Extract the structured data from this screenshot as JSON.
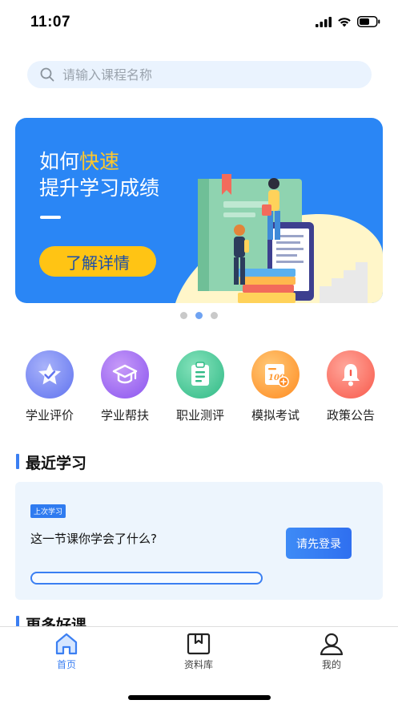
{
  "status": {
    "time": "11:07"
  },
  "search": {
    "placeholder": "请输入课程名称"
  },
  "banner": {
    "title_line1_prefix": "如何",
    "title_line1_highlight": "快速",
    "title_line2": "提升学习成绩",
    "button_label": "了解详情",
    "slide_count": 3,
    "active_slide": 2
  },
  "quick_menu": [
    {
      "label": "学业评价",
      "icon": "star-badge-icon",
      "color_from": "#8f9cf7",
      "color_to": "#5f72ef"
    },
    {
      "label": "学业帮扶",
      "icon": "graduation-cap-icon",
      "color_from": "#b27cf5",
      "color_to": "#8a54ef"
    },
    {
      "label": "职业测评",
      "icon": "clipboard-icon",
      "color_from": "#5fd6a4",
      "color_to": "#2fb985"
    },
    {
      "label": "模拟考试",
      "icon": "exam-score-icon",
      "color_from": "#ffb04a",
      "color_to": "#ff8a1f"
    },
    {
      "label": "政策公告",
      "icon": "bell-icon",
      "color_from": "#ff8c7e",
      "color_to": "#f8584a"
    }
  ],
  "recent": {
    "heading": "最近学习",
    "tag": "上次学习",
    "question": "这一节课你学会了什么?",
    "login_button": "请先登录",
    "progress": 0
  },
  "more": {
    "heading": "更多好课"
  },
  "tabbar": [
    {
      "label": "首页",
      "icon": "home-icon",
      "active": true
    },
    {
      "label": "资料库",
      "icon": "bookmark-book-icon",
      "active": false
    },
    {
      "label": "我的",
      "icon": "user-icon",
      "active": false
    }
  ],
  "colors": {
    "accent": "#3b7ff2",
    "banner_bg": "#2a86f5",
    "banner_button": "#ffc414"
  }
}
